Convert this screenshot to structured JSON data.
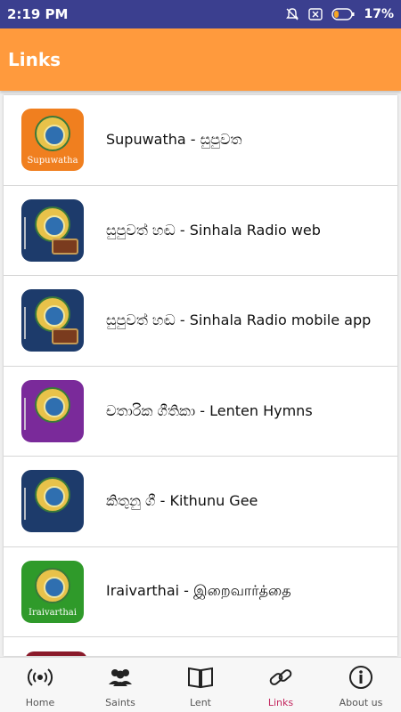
{
  "status_bar": {
    "time": "2:19 PM",
    "battery": "17%",
    "icons": [
      "notifications-muted-icon",
      "sim-disabled-icon",
      "battery-icon"
    ]
  },
  "app_bar": {
    "title": "Links"
  },
  "links": [
    {
      "label": "Supuwatha - සුපුවත",
      "icon_caption": "Supuwatha",
      "icon_color": "#f07f1f",
      "icon": "supuwatha-app-icon"
    },
    {
      "label": "සුපුවත් හඬ - Sinhala Radio web",
      "icon_caption": "",
      "icon_color": "#1d3b6b",
      "icon": "radio-app-icon"
    },
    {
      "label": "සුපුවත් හඬ - Sinhala Radio mobile app",
      "icon_caption": "",
      "icon_color": "#1d3b6b",
      "icon": "radio-app-icon"
    },
    {
      "label": "චතාරික ගීතිකා - Lenten Hymns",
      "icon_caption": "",
      "icon_color": "#7a2a9a",
      "icon": "lenten-hymns-app-icon"
    },
    {
      "label": "කිතුනු ගී - Kithunu Gee",
      "icon_caption": "",
      "icon_color": "#1d3b6b",
      "icon": "kithunu-gee-app-icon"
    },
    {
      "label": "Iraivarthai - இறைவார்த்தை",
      "icon_caption": "Iraivarthai",
      "icon_color": "#2f9a2a",
      "icon": "iraivarthai-app-icon"
    }
  ],
  "bottom_nav": [
    {
      "label": "Home",
      "icon": "radio-waves-icon",
      "active": false
    },
    {
      "label": "Saints",
      "icon": "people-icon",
      "active": false
    },
    {
      "label": "Lent",
      "icon": "book-icon",
      "active": false
    },
    {
      "label": "Links",
      "icon": "link-icon",
      "active": true
    },
    {
      "label": "About us",
      "icon": "info-icon",
      "active": false
    }
  ],
  "colors": {
    "status_bar": "#3b3f8f",
    "app_bar": "#ff9a3d",
    "active_nav": "#c3265e"
  }
}
